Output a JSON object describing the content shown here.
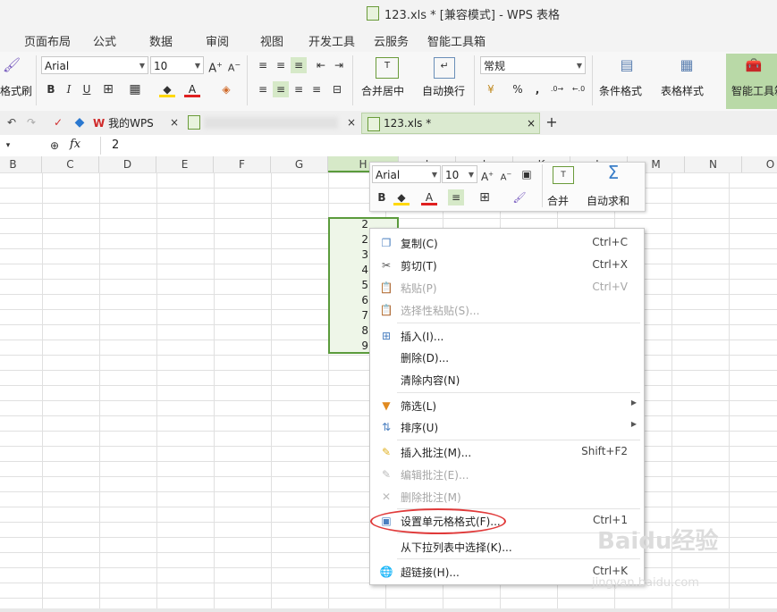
{
  "window": {
    "title": "123.xls * [兼容模式] - WPS 表格"
  },
  "menubar": {
    "items": [
      "页面布局",
      "公式",
      "数据",
      "审阅",
      "视图",
      "开发工具",
      "云服务",
      "智能工具箱"
    ]
  },
  "ribbon": {
    "format_painter": "格式刷",
    "font_name": "Arial",
    "font_size": "10",
    "merge_center": "合并居中",
    "wrap_text": "自动换行",
    "number_format": "常规",
    "conditional_format": "条件格式",
    "table_style": "表格样式",
    "smart_toolbox": "智能工具箱"
  },
  "tabs": {
    "my_wps": "我的WPS",
    "file_tab": "123.xls *"
  },
  "formula_bar": {
    "fx": "fx",
    "value": "2"
  },
  "columns": [
    "B",
    "C",
    "D",
    "E",
    "F",
    "G",
    "H",
    "I",
    "J",
    "K",
    "L",
    "M",
    "N",
    "O"
  ],
  "cells": [
    "2",
    "2",
    "3",
    "4",
    "5",
    "6",
    "7",
    "8",
    "9"
  ],
  "mini_toolbar": {
    "font_name": "Arial",
    "font_size": "10",
    "merge": "合并",
    "autosum": "自动求和"
  },
  "context_menu": {
    "copy": {
      "label": "复制(C)",
      "shortcut": "Ctrl+C"
    },
    "cut": {
      "label": "剪切(T)",
      "shortcut": "Ctrl+X"
    },
    "paste": {
      "label": "粘贴(P)",
      "shortcut": "Ctrl+V"
    },
    "paste_special": {
      "label": "选择性粘贴(S)..."
    },
    "insert": {
      "label": "插入(I)..."
    },
    "delete": {
      "label": "删除(D)..."
    },
    "clear": {
      "label": "清除内容(N)"
    },
    "filter": {
      "label": "筛选(L)"
    },
    "sort": {
      "label": "排序(U)"
    },
    "insert_comment": {
      "label": "插入批注(M)...",
      "shortcut": "Shift+F2"
    },
    "edit_comment": {
      "label": "编辑批注(E)..."
    },
    "delete_comment": {
      "label": "删除批注(M)"
    },
    "format_cells": {
      "label": "设置单元格格式(F)...",
      "shortcut": "Ctrl+1"
    },
    "pick_from_list": {
      "label": "从下拉列表中选择(K)..."
    },
    "hyperlink": {
      "label": "超链接(H)...",
      "shortcut": "Ctrl+K"
    }
  },
  "watermark": {
    "brand": "Baidu经验",
    "url": "jingyan.baidu.com"
  },
  "colors": {
    "accent_green": "#5b9b3c",
    "highlight_red": "#e03a3a"
  }
}
